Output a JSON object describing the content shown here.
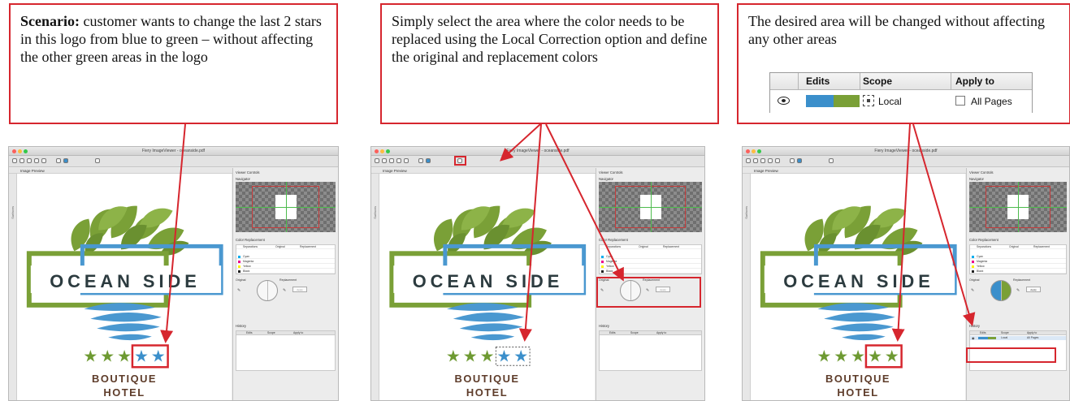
{
  "callouts": [
    {
      "lead": "Scenario:",
      "text": " customer wants to change the last 2 stars in this logo from blue to green – without affecting the other green areas in the logo"
    },
    {
      "text": "Simply select the area where the color needs to be replaced using the Local Correction option and define the original and replacement colors"
    },
    {
      "text": "The desired area will be changed without affecting any other areas",
      "table": {
        "headers": [
          "Edits",
          "Scope",
          "Apply to"
        ],
        "row": {
          "scope": "Local",
          "apply_to": "All Pages"
        }
      }
    }
  ],
  "window": {
    "title": "Fiery ImageViewer - oceanside.pdf",
    "image_preview_label": "Image Preview",
    "sidebar_label": "Surfaces",
    "viewer_controls_label": "Viewer Controls",
    "navigator_label": "Navigator",
    "color_replacement_label": "Color Replacement",
    "separations_header": "Separations",
    "original_header": "Original",
    "replacement_header": "Replacement",
    "separations": [
      "Cyan",
      "Magenta",
      "Yellow",
      "Black"
    ],
    "original_label": "Original",
    "replacement_label": "Replacement",
    "apply_label": "Apply",
    "history_label": "History",
    "history_headers": [
      "Edits",
      "Scope",
      "Apply to"
    ],
    "history_row_scope": "Local",
    "history_row_apply": "All Pages"
  },
  "logo": {
    "name": "OCEAN SIDE",
    "line1": "BOUTIQUE",
    "line2": "HOTEL"
  },
  "colors": {
    "accent_red": "#d6262e",
    "star_green": "#6e9a32",
    "star_blue": "#3b8fcb",
    "leaf_green": "#7aa037",
    "frame_blue": "#4a98d0"
  }
}
